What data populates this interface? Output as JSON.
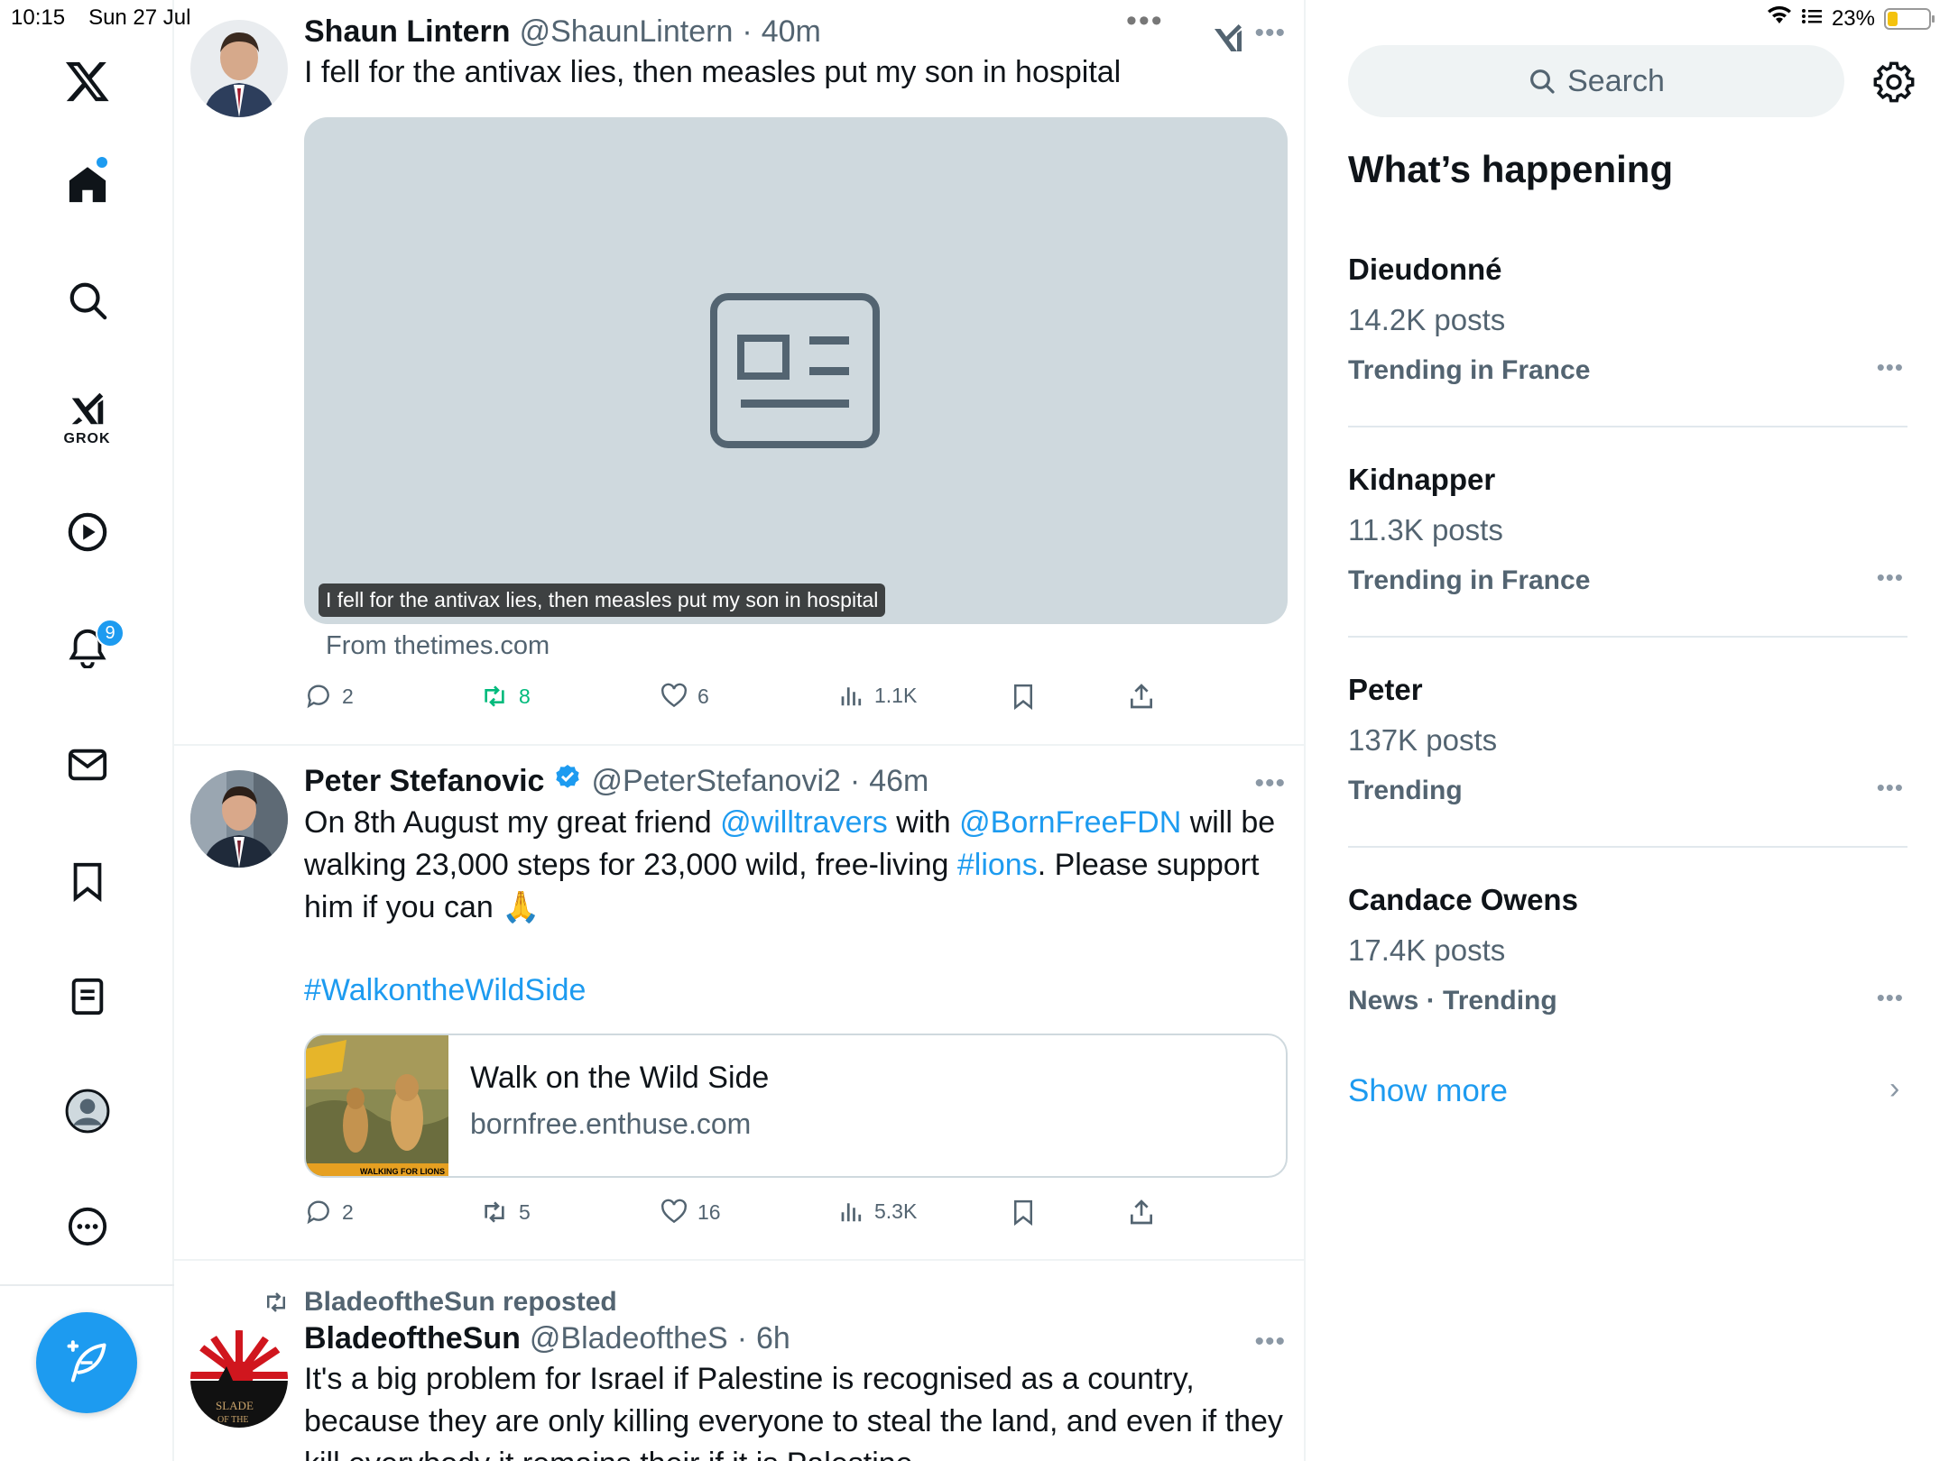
{
  "status": {
    "time": "10:15",
    "date": "Sun 27 Jul",
    "battery": "23%",
    "battery_level": 0.23
  },
  "nav": {
    "grok_label": "GROK",
    "notifications_count": "9"
  },
  "feed": {
    "posts": [
      {
        "name": "Shaun Lintern",
        "handle": "@ShaunLintern",
        "time": "40m",
        "text": "I fell for the antivax lies, then measles put my son in hospital",
        "media_caption": "I fell for the antivax lies, then measles put my son in hospital",
        "source": "From thetimes.com",
        "replies": "2",
        "reposts": "8",
        "likes": "6",
        "views": "1.1K"
      },
      {
        "name": "Peter Stefanovic",
        "handle": "@PeterStefanovi2",
        "time": "46m",
        "text_1": "On 8th August my great friend ",
        "mention_1": "@willtravers",
        "text_2": " with ",
        "mention_2": "@BornFreeFDN",
        "text_3": " will be walking 23,000 steps for 23,000 wild, free-living ",
        "hashtag_1": "#lions",
        "text_4": ". Please support him if you can 🙏",
        "hashtag_2": "#WalkontheWildSide",
        "card_title": "Walk on the Wild Side",
        "card_domain": "bornfree.enthuse.com",
        "card_thumb_text": "WALKING FOR LIONS",
        "replies": "2",
        "reposts": "5",
        "likes": "16",
        "views": "5.3K"
      },
      {
        "reposted_by": "BladeoftheSun reposted",
        "name": "BladeoftheSun",
        "handle": "@BladeoftheS",
        "time": "6h",
        "text": "It's a big problem for Israel if Palestine is recognised as a country, because they are only killing everyone to steal the land, and even if they kill everybody it remains their if it is Palestine..."
      }
    ]
  },
  "sidebar": {
    "search_placeholder": "Search",
    "section_title": "What’s happening",
    "trends": [
      {
        "name": "Dieudonné",
        "count": "14.2K posts",
        "context": "Trending in France"
      },
      {
        "name": "Kidnapper",
        "count": "11.3K posts",
        "context": "Trending in France"
      },
      {
        "name": "Peter",
        "count": "137K posts",
        "context": "Trending"
      },
      {
        "name": "Candace Owens",
        "count": "17.4K posts",
        "context": "News · Trending"
      }
    ],
    "show_more": "Show more"
  },
  "colors": {
    "accent": "#1d9bf0",
    "repost_green": "#00ba7c",
    "muted": "#536471"
  }
}
